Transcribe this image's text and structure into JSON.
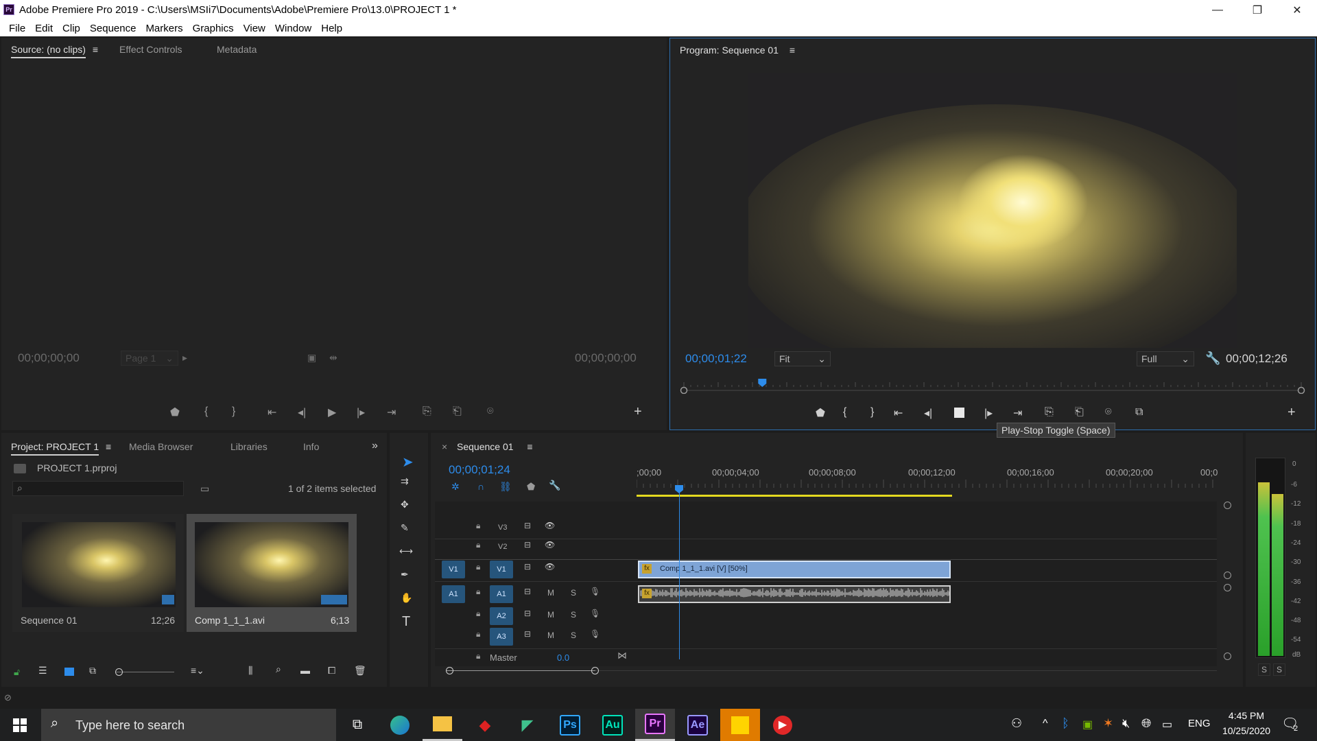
{
  "window": {
    "title": "Adobe Premiere Pro 2019 - C:\\Users\\MSIi7\\Documents\\Adobe\\Premiere Pro\\13.0\\PROJECT 1 *",
    "app_icon": "Pr"
  },
  "menu": [
    "File",
    "Edit",
    "Clip",
    "Sequence",
    "Markers",
    "Graphics",
    "View",
    "Window",
    "Help"
  ],
  "source_panel": {
    "tabs": [
      "Source: (no clips)",
      "Effect Controls",
      "Metadata"
    ],
    "timecode_in": "00;00;00;00",
    "timecode_out": "00;00;00;00",
    "page_select": "Page 1"
  },
  "program_panel": {
    "tab": "Program: Sequence 01",
    "timecode": "00;00;01;22",
    "fit": "Fit",
    "resolution": "Full",
    "duration": "00;00;12;26",
    "tooltip": "Play-Stop Toggle (Space)",
    "playhead_fraction": 0.127
  },
  "project_panel": {
    "tabs": [
      "Project: PROJECT 1",
      "Media Browser",
      "Libraries",
      "Info"
    ],
    "file": "PROJECT 1.prproj",
    "selection": "1 of 2 items selected",
    "items": [
      {
        "name": "Sequence 01",
        "duration": "12;26"
      },
      {
        "name": "Comp 1_1_1.avi",
        "duration": "6;13"
      }
    ]
  },
  "timeline": {
    "tab": "Sequence 01",
    "timecode": "00;00;01;24",
    "ruler": [
      ";00;00",
      "00;00;04;00",
      "00;00;08;00",
      "00;00;12;00",
      "00;00;16;00",
      "00;00;20;00",
      "00;0"
    ],
    "video_tracks": [
      "V3",
      "V2",
      "V1"
    ],
    "audio_tracks": [
      "A1",
      "A2",
      "A3"
    ],
    "source_patch_video": "V1",
    "source_patch_audio": "A1",
    "master_label": "Master",
    "master_value": "0.0",
    "clip_label": "Comp 1_1_1.avi [V] [50%]",
    "m_label": "M",
    "s_label": "S"
  },
  "audio_meter": {
    "scale": [
      "0",
      "-6",
      "-12",
      "-18",
      "-24",
      "-30",
      "-36",
      "-42",
      "-48",
      "-54",
      "dB"
    ],
    "solo": [
      "S",
      "S"
    ],
    "level_left": 0.88,
    "level_right": 0.82
  },
  "taskbar": {
    "search_placeholder": "Type here to search",
    "apps": [
      "Ps",
      "Au",
      "Pr",
      "Ae"
    ],
    "lang": "ENG",
    "time": "4:45 PM",
    "date": "10/25/2020",
    "notifications": "2"
  },
  "colors": {
    "accent_blue": "#2d8ceb",
    "track_blue": "#26557c",
    "clip_blue": "#7ea4d6",
    "work_area_yellow": "#e4d91f",
    "premiere_purple": "#9a7bd1"
  }
}
